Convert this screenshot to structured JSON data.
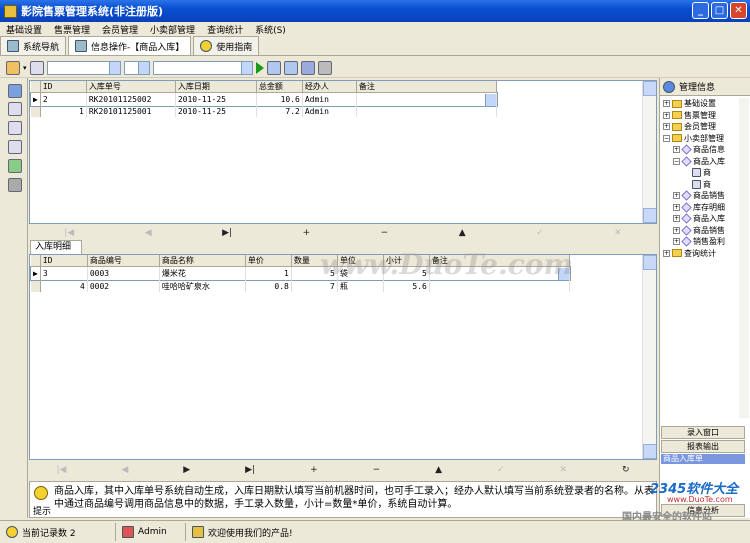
{
  "window": {
    "title": "影院售票管理系统(非注册版)"
  },
  "menu": [
    "基础设置",
    "售票管理",
    "会员管理",
    "小卖部管理",
    "查询统计",
    "系统(S)"
  ],
  "tabs": [
    {
      "label": "系统导航"
    },
    {
      "label": "信息操作-【商品入库】"
    },
    {
      "label": "使用指南"
    }
  ],
  "top_grid": {
    "columns": [
      "ID",
      "入库单号",
      "入库日期",
      "总金额",
      "经办人",
      "备注"
    ],
    "rows": [
      {
        "id": "2",
        "no": "RK20101125002",
        "date": "2010-11-25",
        "amount": "10.6",
        "handler": "Admin",
        "note": ""
      },
      {
        "id": "1",
        "no": "RK20101125001",
        "date": "2010-11-25",
        "amount": "7.2",
        "handler": "Admin",
        "note": ""
      }
    ]
  },
  "nav_top": [
    "|◀",
    "◀",
    "▶|",
    "+",
    "−",
    "▲",
    "✓",
    "✕"
  ],
  "detail_tab": "入库明细",
  "bottom_grid": {
    "columns": [
      "ID",
      "商品编号",
      "商品名称",
      "单价",
      "数量",
      "单位",
      "小计",
      "备注"
    ],
    "rows": [
      {
        "id": "3",
        "code": "0003",
        "name": "爆米花",
        "price": "1",
        "qty": "5",
        "unit": "袋",
        "subtotal": "5",
        "note": ""
      },
      {
        "id": "4",
        "code": "0002",
        "name": "哇哈哈矿泉水",
        "price": "0.8",
        "qty": "7",
        "unit": "瓶",
        "subtotal": "5.6",
        "note": ""
      }
    ]
  },
  "nav_bottom": [
    "|◀",
    "◀",
    "▶",
    "▶|",
    "+",
    "−",
    "▲",
    "✓",
    "✕",
    "↻"
  ],
  "right_panel": {
    "title": "管理信息",
    "tree": [
      {
        "label": "基础设置",
        "level": 0,
        "type": "folder",
        "exp": "+"
      },
      {
        "label": "售票管理",
        "level": 0,
        "type": "folder",
        "exp": "+"
      },
      {
        "label": "会员管理",
        "level": 0,
        "type": "folder",
        "exp": "+"
      },
      {
        "label": "小卖部管理",
        "level": 0,
        "type": "folder",
        "exp": "−"
      },
      {
        "label": "商品信息",
        "level": 1,
        "type": "item",
        "exp": "+"
      },
      {
        "label": "商品入库",
        "level": 1,
        "type": "item",
        "exp": "−"
      },
      {
        "label": "商",
        "level": 2,
        "type": "doc",
        "exp": ""
      },
      {
        "label": "商",
        "level": 2,
        "type": "doc",
        "exp": ""
      },
      {
        "label": "商品销售",
        "level": 1,
        "type": "item",
        "exp": "+"
      },
      {
        "label": "库存明细",
        "level": 1,
        "type": "item",
        "exp": "+"
      },
      {
        "label": "商品入库",
        "level": 1,
        "type": "item",
        "exp": "+"
      },
      {
        "label": "商品销售",
        "level": 1,
        "type": "item",
        "exp": "+"
      },
      {
        "label": "销售盈利",
        "level": 1,
        "type": "item",
        "exp": "+"
      },
      {
        "label": "查询统计",
        "level": 0,
        "type": "folder",
        "exp": "+"
      }
    ],
    "buttons": [
      "录入窗口",
      "报表输出"
    ],
    "selected": "商品入库单",
    "bottom_btn": "信息分析"
  },
  "hint": {
    "label": "提示",
    "text": "商品入库，其中入库单号系统自动生成，入库日期默认填写当前机器时间，也可手工录入；经办人默认填写当前系统登录者的名称。从表中通过商品编号调用商品信息中的数据，手工录入数量，小计=数量*单价，系统自动计算。"
  },
  "status": {
    "record_count": "当前记录数 2",
    "user": "Admin",
    "welcome": "欢迎使用我们的产品!"
  },
  "watermark": "www.DuoTe.com",
  "logo": {
    "brand": "2345软件大全",
    "site": "www.DuoTe.com",
    "slogan": "国内最安全的软件站"
  }
}
